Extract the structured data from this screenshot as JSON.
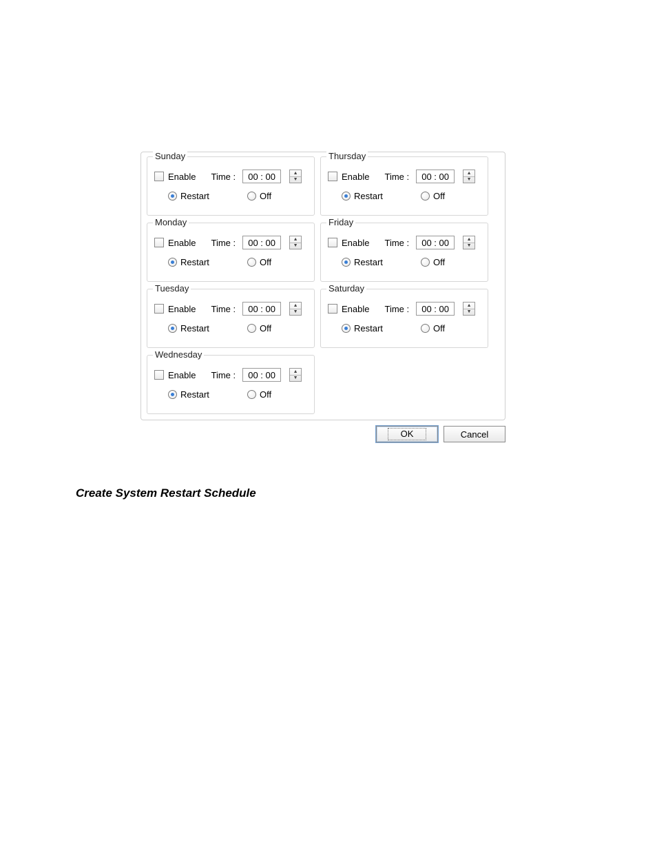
{
  "labels": {
    "enable": "Enable",
    "time": "Time :",
    "restart": "Restart",
    "off": "Off",
    "ok": "OK",
    "cancel": "Cancel"
  },
  "days": [
    {
      "name": "Sunday",
      "enable": false,
      "time": "00 : 00",
      "mode": "restart"
    },
    {
      "name": "Monday",
      "enable": false,
      "time": "00 : 00",
      "mode": "restart"
    },
    {
      "name": "Tuesday",
      "enable": false,
      "time": "00 : 00",
      "mode": "restart"
    },
    {
      "name": "Wednesday",
      "enable": false,
      "time": "00 : 00",
      "mode": "restart"
    },
    {
      "name": "Thursday",
      "enable": false,
      "time": "00 : 00",
      "mode": "restart"
    },
    {
      "name": "Friday",
      "enable": false,
      "time": "00 : 00",
      "mode": "restart"
    },
    {
      "name": "Saturday",
      "enable": false,
      "time": "00 : 00",
      "mode": "restart"
    }
  ],
  "caption": "Create System Restart Schedule"
}
